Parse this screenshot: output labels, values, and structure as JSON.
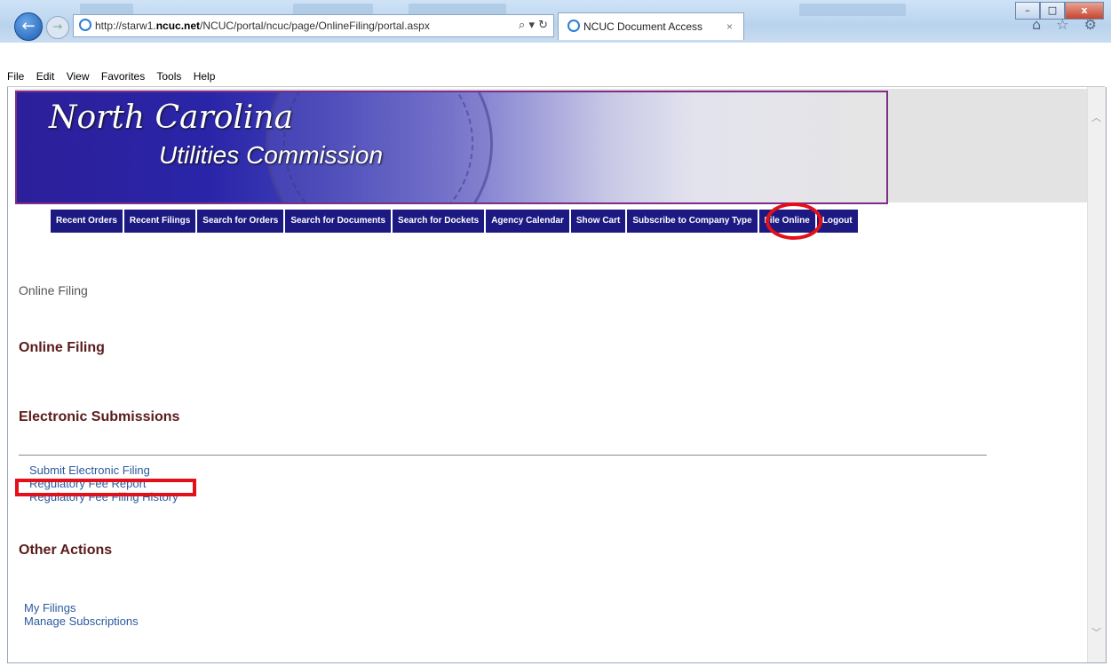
{
  "browser": {
    "url_prefix": "http://starw1.",
    "url_host": "ncuc.net",
    "url_path": "/NCUC/portal/ncuc/page/OnlineFiling/portal.aspx",
    "address_controls": "⌕ ▾ ↻",
    "tab_title": "NCUC Document Access",
    "tab_close": "×",
    "tool_icons": "⌂ ☆ ⚙",
    "win_min": "–",
    "win_max": "□",
    "win_close": "x"
  },
  "menu": [
    "File",
    "Edit",
    "View",
    "Favorites",
    "Tools",
    "Help"
  ],
  "banner": {
    "title": "North Carolina",
    "subtitle": "Utilities Commission"
  },
  "nav": [
    "Recent Orders",
    "Recent Filings",
    "Search for Orders",
    "Search for Documents",
    "Search for Dockets",
    "Agency Calendar",
    "Show Cart",
    "Subscribe to Company Type",
    "File Online",
    "Logout"
  ],
  "page": {
    "breadcrumb": "Online Filing",
    "heading": "Online Filing",
    "section_electronic": "Electronic Submissions",
    "electronic_links": [
      "Submit Electronic Filing",
      "Regulatory Fee Report",
      "Regulatory Fee Filing History"
    ],
    "section_other": "Other Actions",
    "other_links": [
      "My Filings",
      "Manage Subscriptions"
    ]
  }
}
